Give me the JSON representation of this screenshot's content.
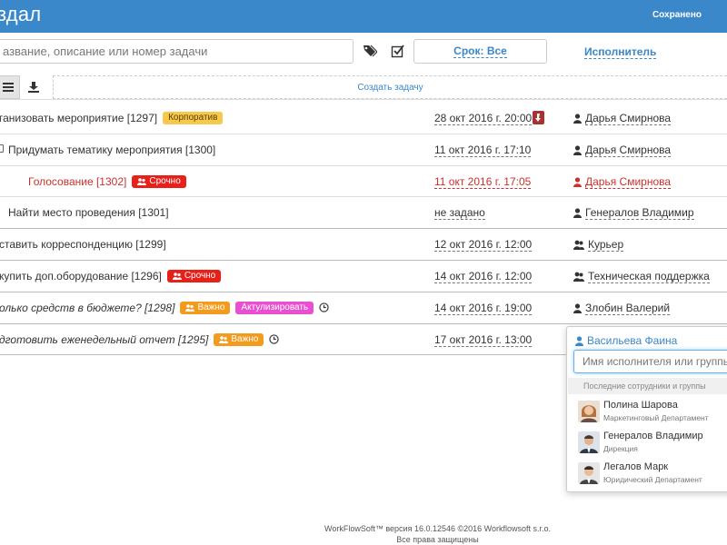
{
  "header": {
    "title": "здал",
    "saved_label": "Сохранено"
  },
  "filters": {
    "search_placeholder": "азвание, описание или номер задачи",
    "deadline_label": "Срок: Все",
    "assignee_label": "Исполнитель"
  },
  "toolbar": {
    "create_task_label": "Создать задачу"
  },
  "tasks": [
    {
      "name": "ганизовать мероприятие [1297]",
      "badges": [
        {
          "label": "Корпоратив"
        }
      ],
      "date": "28 окт 2016 г. 20:00",
      "assignee": "Дарья Смирнова"
    },
    {
      "name": "Придумать тематику мероприятия [1300]",
      "badges": [],
      "date": "11 окт 2016 г. 17:10",
      "assignee": "Дарья Смирнова"
    },
    {
      "name": "Голосование [1302]",
      "badges": [
        {
          "label": "Срочно"
        }
      ],
      "date": "11 окт 2016 г. 17:05",
      "assignee": "Дарья Смирнова"
    },
    {
      "name": "Найти место проведения [1301]",
      "badges": [],
      "date": "не задано",
      "assignee": "Генералов Владимир"
    },
    {
      "name": "ставить корреспонденцию [1299]",
      "badges": [],
      "date": "12 окт 2016 г. 12:00",
      "assignee": "Курьер"
    },
    {
      "name": "купить доп.оборудование [1296]",
      "badges": [
        {
          "label": "Срочно"
        }
      ],
      "date": "14 окт 2016 г. 12:00",
      "assignee": "Техническая поддержка"
    },
    {
      "name": "олько средств в бюджете? [1298]",
      "badges": [
        {
          "label": "Важно"
        },
        {
          "label": "Актулизировать"
        }
      ],
      "date": "14 окт 2016 г. 19:00",
      "assignee": "Злобин Валерий"
    },
    {
      "name": "дготовить еженедельный отчет [1295]",
      "badges": [
        {
          "label": "Важно"
        }
      ],
      "date": "17 окт 2016 г. 13:00",
      "assignee": ""
    }
  ],
  "popup": {
    "current_assignee": "Васильева Фаина",
    "input_placeholder": "Имя исполнителя или группы",
    "recent_label": "Последние сотрудники и группы",
    "people": [
      {
        "name": "Полина Шарова",
        "dept": "Маркетинговый Департамент"
      },
      {
        "name": "Генералов Владимир",
        "dept": "Дирекция"
      },
      {
        "name": "Легалов Марк",
        "dept": "Юридический Департамент"
      }
    ]
  },
  "footer": {
    "version_line": "WorkFlowSoft™ версия 16.0.12546 ©2016 Workflowsoft s.r.o.",
    "rights_line": "Все права защищены"
  },
  "colors": {
    "header": "#3a87c9",
    "link": "#3a87c9",
    "urgent": "#e8201a",
    "corporate": "#f6c94c",
    "important": "#f29b1c",
    "actualize": "#e84fd1",
    "overdue_text": "#c9302c"
  }
}
